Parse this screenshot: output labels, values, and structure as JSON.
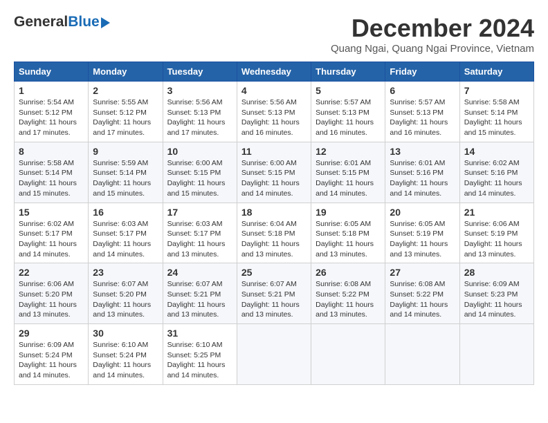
{
  "header": {
    "logo_general": "General",
    "logo_blue": "Blue",
    "month_year": "December 2024",
    "location": "Quang Ngai, Quang Ngai Province, Vietnam"
  },
  "days_of_week": [
    "Sunday",
    "Monday",
    "Tuesday",
    "Wednesday",
    "Thursday",
    "Friday",
    "Saturday"
  ],
  "weeks": [
    [
      {
        "day": "1",
        "sunrise": "Sunrise: 5:54 AM",
        "sunset": "Sunset: 5:12 PM",
        "daylight": "Daylight: 11 hours and 17 minutes."
      },
      {
        "day": "2",
        "sunrise": "Sunrise: 5:55 AM",
        "sunset": "Sunset: 5:12 PM",
        "daylight": "Daylight: 11 hours and 17 minutes."
      },
      {
        "day": "3",
        "sunrise": "Sunrise: 5:56 AM",
        "sunset": "Sunset: 5:13 PM",
        "daylight": "Daylight: 11 hours and 17 minutes."
      },
      {
        "day": "4",
        "sunrise": "Sunrise: 5:56 AM",
        "sunset": "Sunset: 5:13 PM",
        "daylight": "Daylight: 11 hours and 16 minutes."
      },
      {
        "day": "5",
        "sunrise": "Sunrise: 5:57 AM",
        "sunset": "Sunset: 5:13 PM",
        "daylight": "Daylight: 11 hours and 16 minutes."
      },
      {
        "day": "6",
        "sunrise": "Sunrise: 5:57 AM",
        "sunset": "Sunset: 5:13 PM",
        "daylight": "Daylight: 11 hours and 16 minutes."
      },
      {
        "day": "7",
        "sunrise": "Sunrise: 5:58 AM",
        "sunset": "Sunset: 5:14 PM",
        "daylight": "Daylight: 11 hours and 15 minutes."
      }
    ],
    [
      {
        "day": "8",
        "sunrise": "Sunrise: 5:58 AM",
        "sunset": "Sunset: 5:14 PM",
        "daylight": "Daylight: 11 hours and 15 minutes."
      },
      {
        "day": "9",
        "sunrise": "Sunrise: 5:59 AM",
        "sunset": "Sunset: 5:14 PM",
        "daylight": "Daylight: 11 hours and 15 minutes."
      },
      {
        "day": "10",
        "sunrise": "Sunrise: 6:00 AM",
        "sunset": "Sunset: 5:15 PM",
        "daylight": "Daylight: 11 hours and 15 minutes."
      },
      {
        "day": "11",
        "sunrise": "Sunrise: 6:00 AM",
        "sunset": "Sunset: 5:15 PM",
        "daylight": "Daylight: 11 hours and 14 minutes."
      },
      {
        "day": "12",
        "sunrise": "Sunrise: 6:01 AM",
        "sunset": "Sunset: 5:15 PM",
        "daylight": "Daylight: 11 hours and 14 minutes."
      },
      {
        "day": "13",
        "sunrise": "Sunrise: 6:01 AM",
        "sunset": "Sunset: 5:16 PM",
        "daylight": "Daylight: 11 hours and 14 minutes."
      },
      {
        "day": "14",
        "sunrise": "Sunrise: 6:02 AM",
        "sunset": "Sunset: 5:16 PM",
        "daylight": "Daylight: 11 hours and 14 minutes."
      }
    ],
    [
      {
        "day": "15",
        "sunrise": "Sunrise: 6:02 AM",
        "sunset": "Sunset: 5:17 PM",
        "daylight": "Daylight: 11 hours and 14 minutes."
      },
      {
        "day": "16",
        "sunrise": "Sunrise: 6:03 AM",
        "sunset": "Sunset: 5:17 PM",
        "daylight": "Daylight: 11 hours and 14 minutes."
      },
      {
        "day": "17",
        "sunrise": "Sunrise: 6:03 AM",
        "sunset": "Sunset: 5:17 PM",
        "daylight": "Daylight: 11 hours and 13 minutes."
      },
      {
        "day": "18",
        "sunrise": "Sunrise: 6:04 AM",
        "sunset": "Sunset: 5:18 PM",
        "daylight": "Daylight: 11 hours and 13 minutes."
      },
      {
        "day": "19",
        "sunrise": "Sunrise: 6:05 AM",
        "sunset": "Sunset: 5:18 PM",
        "daylight": "Daylight: 11 hours and 13 minutes."
      },
      {
        "day": "20",
        "sunrise": "Sunrise: 6:05 AM",
        "sunset": "Sunset: 5:19 PM",
        "daylight": "Daylight: 11 hours and 13 minutes."
      },
      {
        "day": "21",
        "sunrise": "Sunrise: 6:06 AM",
        "sunset": "Sunset: 5:19 PM",
        "daylight": "Daylight: 11 hours and 13 minutes."
      }
    ],
    [
      {
        "day": "22",
        "sunrise": "Sunrise: 6:06 AM",
        "sunset": "Sunset: 5:20 PM",
        "daylight": "Daylight: 11 hours and 13 minutes."
      },
      {
        "day": "23",
        "sunrise": "Sunrise: 6:07 AM",
        "sunset": "Sunset: 5:20 PM",
        "daylight": "Daylight: 11 hours and 13 minutes."
      },
      {
        "day": "24",
        "sunrise": "Sunrise: 6:07 AM",
        "sunset": "Sunset: 5:21 PM",
        "daylight": "Daylight: 11 hours and 13 minutes."
      },
      {
        "day": "25",
        "sunrise": "Sunrise: 6:07 AM",
        "sunset": "Sunset: 5:21 PM",
        "daylight": "Daylight: 11 hours and 13 minutes."
      },
      {
        "day": "26",
        "sunrise": "Sunrise: 6:08 AM",
        "sunset": "Sunset: 5:22 PM",
        "daylight": "Daylight: 11 hours and 13 minutes."
      },
      {
        "day": "27",
        "sunrise": "Sunrise: 6:08 AM",
        "sunset": "Sunset: 5:22 PM",
        "daylight": "Daylight: 11 hours and 14 minutes."
      },
      {
        "day": "28",
        "sunrise": "Sunrise: 6:09 AM",
        "sunset": "Sunset: 5:23 PM",
        "daylight": "Daylight: 11 hours and 14 minutes."
      }
    ],
    [
      {
        "day": "29",
        "sunrise": "Sunrise: 6:09 AM",
        "sunset": "Sunset: 5:24 PM",
        "daylight": "Daylight: 11 hours and 14 minutes."
      },
      {
        "day": "30",
        "sunrise": "Sunrise: 6:10 AM",
        "sunset": "Sunset: 5:24 PM",
        "daylight": "Daylight: 11 hours and 14 minutes."
      },
      {
        "day": "31",
        "sunrise": "Sunrise: 6:10 AM",
        "sunset": "Sunset: 5:25 PM",
        "daylight": "Daylight: 11 hours and 14 minutes."
      },
      null,
      null,
      null,
      null
    ]
  ]
}
